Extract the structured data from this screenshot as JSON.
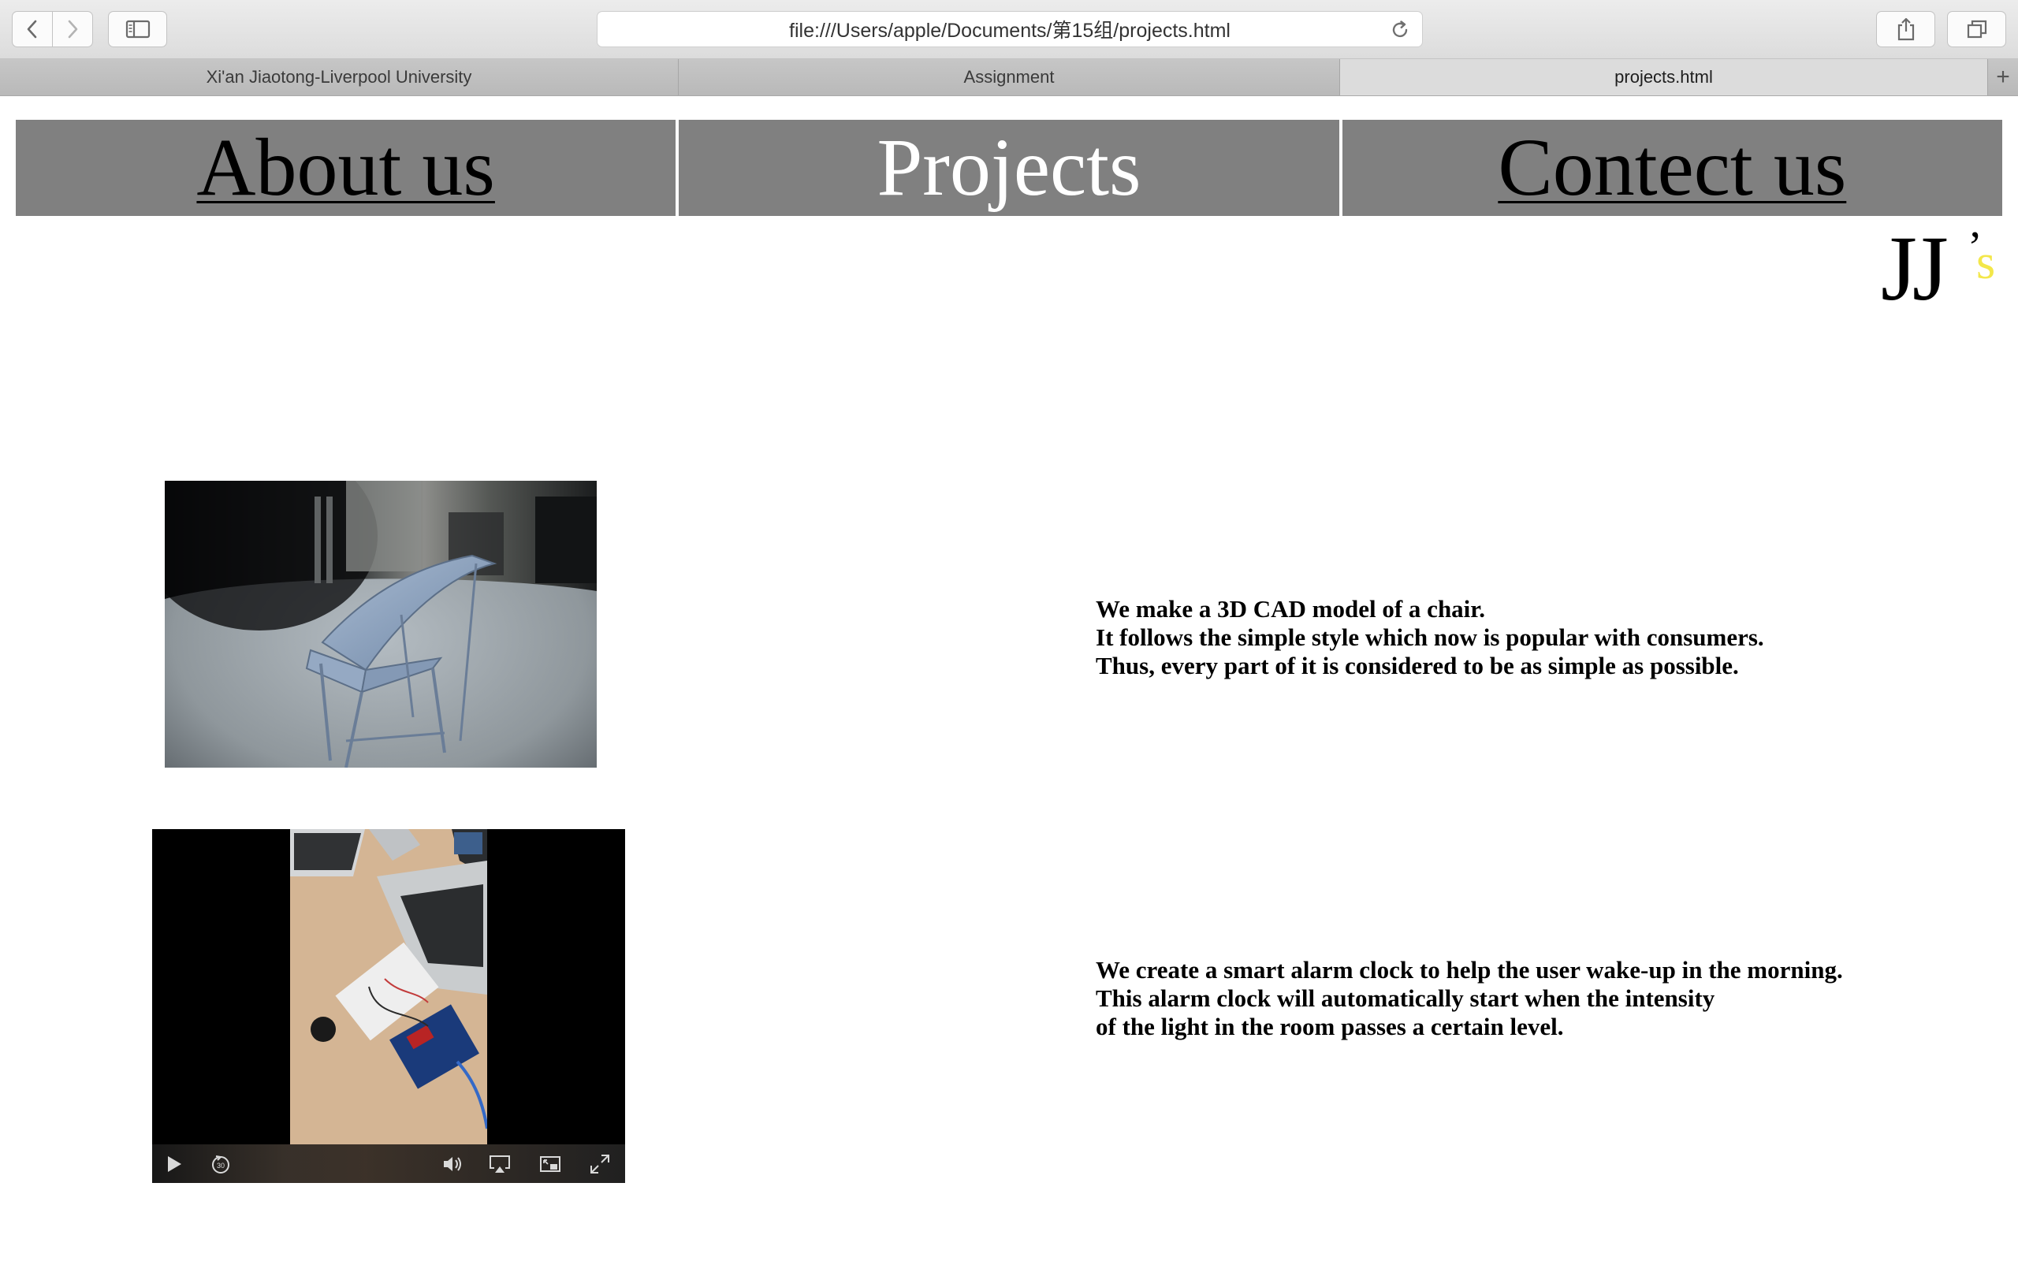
{
  "browser": {
    "url": "file:///Users/apple/Documents/第15组/projects.html",
    "tabs": [
      {
        "label": "Xi'an Jiaotong-Liverpool University",
        "active": false
      },
      {
        "label": "Assignment",
        "active": false
      },
      {
        "label": "projects.html",
        "active": true
      }
    ],
    "icons": [
      "back-icon",
      "forward-icon",
      "sidebar-icon",
      "reload-icon",
      "share-icon",
      "tabs-overview-icon",
      "new-tab-icon"
    ]
  },
  "site": {
    "nav": [
      {
        "label": "About us",
        "current": false
      },
      {
        "label": "Projects",
        "current": true
      },
      {
        "label": "Contect us",
        "current": false
      }
    ],
    "logo": {
      "main": "JJ",
      "apostrophe": "’",
      "suffix": "s",
      "suffix_color": "#f3e74a"
    },
    "nav_bg_color": "#808080"
  },
  "projects": [
    {
      "media": "image",
      "lines": [
        "We make a 3D CAD model of a chair.",
        "It follows the simple style which now is popular with consumers.",
        "Thus, every part of it is considered to be as simple as possible."
      ]
    },
    {
      "media": "video",
      "video_controls": [
        "play-icon",
        "skip-back-30-icon",
        "volume-icon",
        "airplay-icon",
        "picture-in-picture-icon",
        "fullscreen-icon"
      ],
      "lines": [
        "We create a smart alarm clock to help the user wake-up in the morning.",
        "This alarm clock will automatically start when the intensity",
        "of the light in the room passes a certain level."
      ]
    }
  ]
}
